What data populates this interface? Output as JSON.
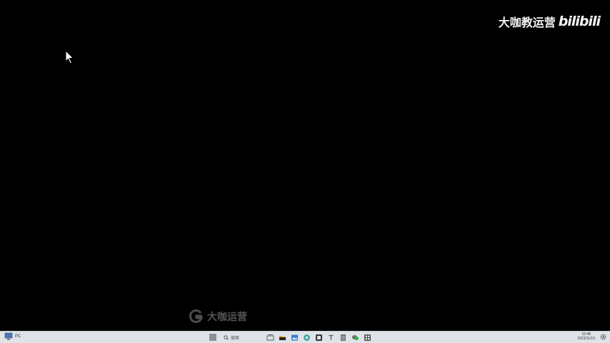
{
  "watermark": {
    "channel_name": "大咖教运营",
    "site_logo": "bilibili"
  },
  "brand": {
    "text": "大咖运营"
  },
  "taskbar": {
    "left_label": "PC",
    "search_placeholder": "搜索",
    "apps": [
      {
        "name": "taskview",
        "color": "#5b6470"
      },
      {
        "name": "file-explorer",
        "color": "#e0a526"
      },
      {
        "name": "image-viewer",
        "color": "#3d7bd6"
      },
      {
        "name": "browser",
        "color": "#2a9d8f"
      },
      {
        "name": "capture",
        "color": "#444444"
      },
      {
        "name": "text",
        "color": "#555555"
      },
      {
        "name": "notes",
        "color": "#6d6d6d"
      },
      {
        "name": "chat",
        "color": "#2bb24c"
      },
      {
        "name": "settings-app",
        "color": "#4a4a4a"
      }
    ],
    "clock": {
      "time": "16:48",
      "date": "2023/11/19"
    }
  }
}
